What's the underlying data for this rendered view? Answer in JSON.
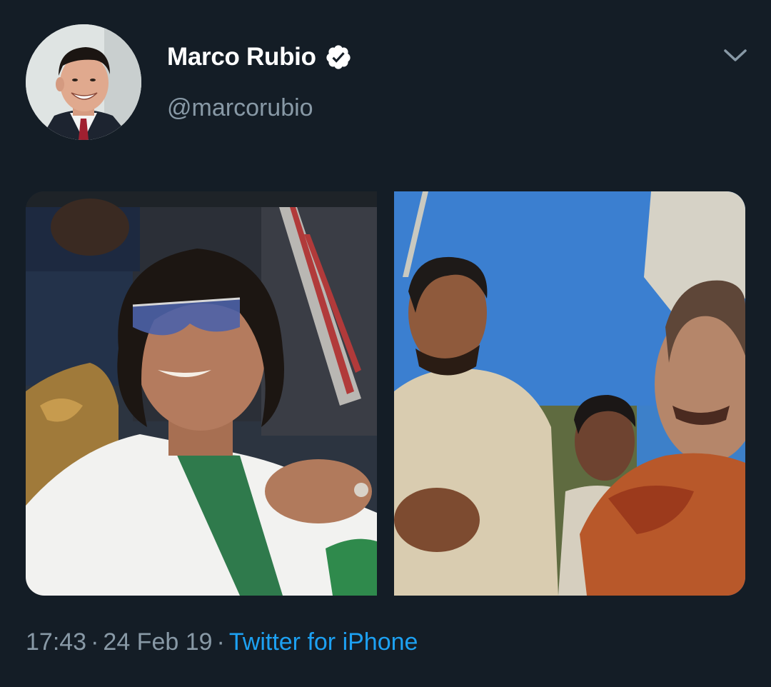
{
  "author": {
    "display_name": "Marco Rubio",
    "handle": "@marcorubio",
    "verified": true,
    "avatar_icon": "user-avatar"
  },
  "menu": {
    "icon": "chevron-down-icon"
  },
  "media": {
    "count": 2
  },
  "meta": {
    "time": "17:43",
    "separator": "·",
    "date": "24 Feb 19",
    "source": "Twitter for iPhone"
  },
  "colors": {
    "background": "#141d26",
    "primary_text": "#ffffff",
    "secondary_text": "#8899a6",
    "link": "#1da1f2",
    "verified_badge": "#ffffff"
  }
}
